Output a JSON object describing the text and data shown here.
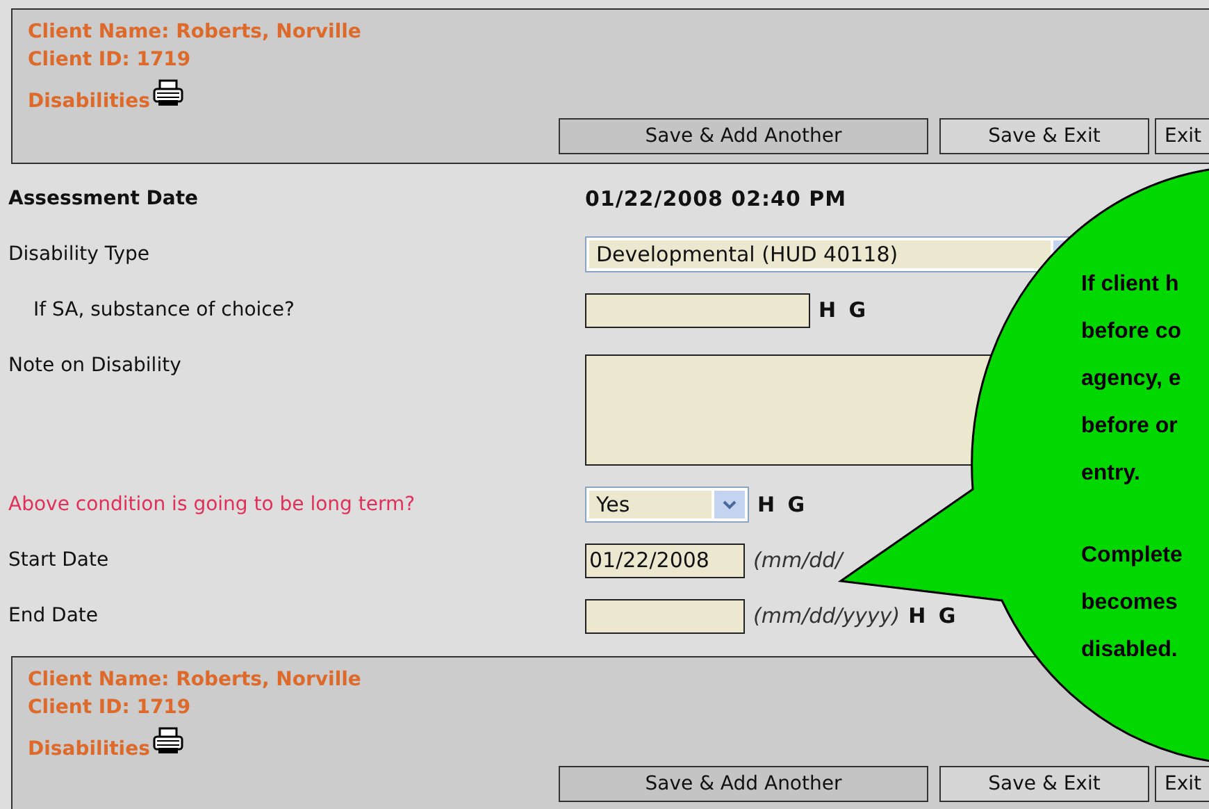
{
  "header": {
    "client_name": "Client Name: Roberts, Norville",
    "client_id": "Client ID: 1719",
    "section": "Disabilities",
    "buttons": [
      "Save & Add Another",
      "Save & Exit",
      "Exit"
    ]
  },
  "form": {
    "rows": [
      {
        "kind": "static",
        "label": "Assessment Date",
        "value": "01/22/2008 02:40 PM",
        "indented": false,
        "highlighted": false
      },
      {
        "kind": "select-wide",
        "label": "Disability Type",
        "value": "Developmental (HUD 40118)",
        "indented": false,
        "highlighted": false
      },
      {
        "kind": "text",
        "label": "If SA, substance of choice?",
        "suffix": "H G",
        "indented": true,
        "highlighted": false
      },
      {
        "kind": "textarea",
        "label": "Note on Disability",
        "indented": false,
        "highlighted": false
      },
      {
        "kind": "select",
        "label": "Above condition is going to be long term?",
        "value": "Yes",
        "suffix": "H G",
        "indented": false,
        "highlighted": true
      },
      {
        "kind": "date",
        "label": "Start Date",
        "value": "01/22/2008",
        "hint": "(mm/dd/",
        "indented": false,
        "highlighted": false
      },
      {
        "kind": "date",
        "label": "End Date",
        "hint": "(mm/dd/yyyy)",
        "suffix": "H G",
        "indented": false,
        "highlighted": false
      }
    ]
  },
  "footer": {
    "client_name": "Client Name: Roberts, Norville",
    "client_id": "Client ID: 1719",
    "section": "Disabilities",
    "buttons": [
      "Save & Add Another",
      "Save & Exit",
      "Exit"
    ]
  },
  "callout": {
    "paragraphs": [
      [
        "If client h",
        "before co",
        "agency, e",
        "before or",
        "entry."
      ],
      [
        "Complete",
        "becomes",
        "disabled."
      ]
    ]
  }
}
